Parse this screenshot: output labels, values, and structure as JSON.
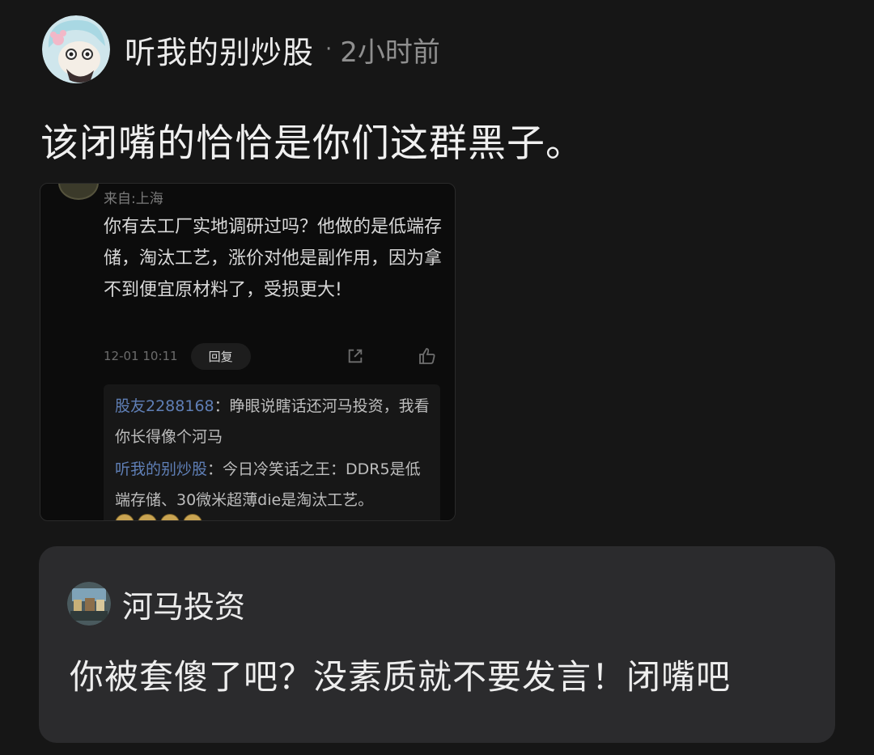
{
  "post": {
    "author": "听我的别炒股",
    "separator": "·",
    "time": "2小时前",
    "text": "该闭嘴的恰恰是你们这群黑子。"
  },
  "embedded_screenshot": {
    "location": "来自:上海",
    "comment": "你有去工厂实地调研过吗？他做的是低端存储，淘汰工艺，涨价对他是副作用，因为拿不到便宜原材料了，受损更大!",
    "date": "12-01 10:11",
    "reply_label": "回复",
    "share_icon": "share-icon",
    "like_icon": "thumbs-up-icon",
    "sub_replies": [
      {
        "user": "股友2288168",
        "text": "：睁眼说瞎话还河马投资，我看你长得像个河马"
      },
      {
        "user": "听我的别炒股",
        "text": "：今日冷笑话之王：DDR5是低端存储、30微米超薄die是淘汰工艺。"
      }
    ]
  },
  "quoted_reply": {
    "user": "河马投资",
    "text": "你被套傻了吧？没素质就不要发言！闭嘴吧"
  },
  "colors": {
    "background": "#161616",
    "quote_box": "#2b2b2d",
    "link_user": "#5f7fb6",
    "muted": "#8f8f8f"
  }
}
